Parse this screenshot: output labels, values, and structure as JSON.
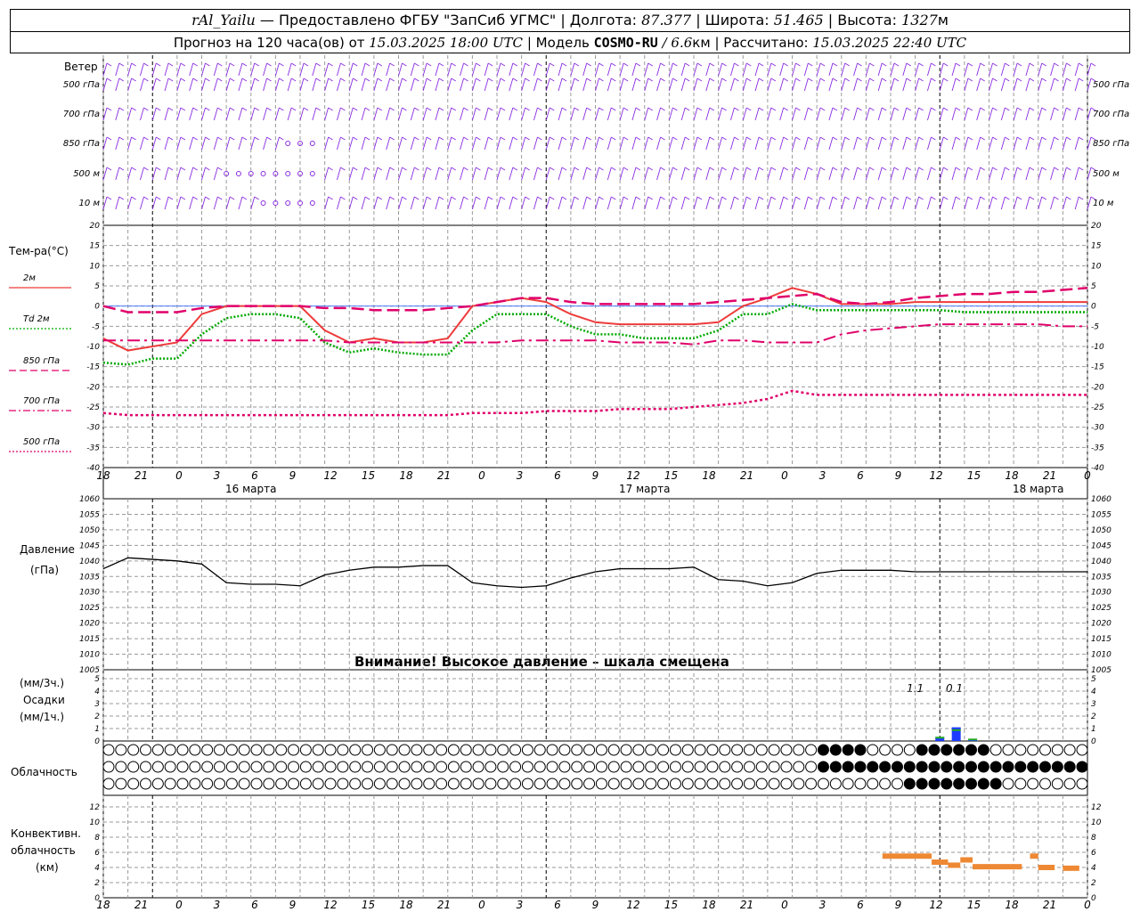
{
  "header": {
    "station": "rAl_Yailu",
    "provider": "— Предоставлено ФГБУ \"ЗапСиб УГМС\"",
    "lon_label": "Долгота:",
    "lon_value": "87.377",
    "lat_label": "Широта:",
    "lat_value": "51.465",
    "alt_label": "Высота:",
    "alt_value": "1327",
    "alt_unit": "м",
    "forecast_label": "Прогноз на 120 часа(ов) от",
    "forecast_from": "15.03.2025 18:00 UTC",
    "model_label": "Модель",
    "model_name": "COSMO-RU",
    "model_res": "/ 6.6",
    "model_res_unit": "км",
    "calc_label": "Рассчитано:",
    "calc_time": "15.03.2025 22:40 UTC"
  },
  "panels": {
    "wind": {
      "title": "Ветер",
      "levels": [
        "500 гПа",
        "700 гПа",
        "850 гПа",
        "500 м",
        "10  м"
      ],
      "color": "#8a2be2"
    },
    "temp": {
      "title": "Тем-ра(°C)",
      "legend": [
        {
          "name": "2м",
          "style": "solid",
          "color": "#ee3b3b"
        },
        {
          "name": "Td  2м",
          "style": "dotted",
          "color": "#00aa00"
        },
        {
          "name": "850 гПа",
          "style": "dashed",
          "color": "#e0006a"
        },
        {
          "name": "700 гПа",
          "style": "dashdot",
          "color": "#e0006a"
        },
        {
          "name": "500 гПа",
          "style": "dotted",
          "color": "#e0006a"
        }
      ],
      "yticks": [
        "20",
        "15",
        "10",
        "5",
        "0",
        "-5",
        "-10",
        "-15",
        "-20",
        "-25",
        "-30",
        "-35",
        "-40"
      ]
    },
    "pressure": {
      "title": "Давление",
      "unit": "(гПа)",
      "warning": "Внимание! Высокое давление – шкала смещена",
      "yticks": [
        "1060",
        "1055",
        "1050",
        "1045",
        "1040",
        "1035",
        "1030",
        "1025",
        "1020",
        "1015",
        "1010",
        "1005"
      ]
    },
    "precip": {
      "title": "Осадки",
      "unit_top": "(мм/3ч.)",
      "unit_bottom": "(мм/1ч.)",
      "yticks": [
        "5",
        "4",
        "3",
        "2",
        "1",
        "0"
      ],
      "annotations": [
        "1.1",
        "0.1"
      ]
    },
    "cloud": {
      "title": "Облачность"
    },
    "conv": {
      "title1": "Конвективн.",
      "title2": "облачность",
      "title3": "(км)",
      "yticks": [
        "12",
        "10",
        "8",
        "6",
        "4",
        "2",
        "0"
      ]
    }
  },
  "x_axis": {
    "hour_labels": [
      "18",
      "21",
      "0",
      "3",
      "6",
      "9",
      "12",
      "15",
      "18",
      "21",
      "0",
      "3",
      "6",
      "9",
      "12",
      "15",
      "18",
      "21",
      "0",
      "3",
      "6",
      "9",
      "12",
      "15",
      "18",
      "21",
      "0"
    ],
    "dates": [
      "16 марта",
      "17 марта",
      "18 марта"
    ]
  },
  "chart_data": [
    {
      "type": "line",
      "title": "Тем-ра(°C)",
      "x_hours": [
        0,
        3,
        6,
        9,
        12,
        15,
        18,
        21,
        24,
        27,
        30,
        33,
        36,
        39,
        42,
        45,
        48,
        51,
        54,
        57,
        60,
        63,
        66,
        69,
        72,
        75,
        78,
        81,
        84,
        87,
        90,
        93,
        96,
        99,
        102,
        105,
        108,
        111,
        114,
        117,
        120
      ],
      "ylim": [
        -40,
        20
      ],
      "series": [
        {
          "name": "2м",
          "values": [
            -8,
            -11,
            -10,
            -9,
            -2,
            0,
            0,
            0,
            0,
            -6,
            -9,
            -8,
            -9,
            -9,
            -8,
            0,
            1,
            2,
            1,
            -2,
            -4,
            -4.5,
            -4.5,
            -4.5,
            -4.5,
            -4,
            0,
            2,
            4.5,
            3,
            0.5,
            0.5,
            0.5,
            1,
            1,
            1,
            1,
            1,
            1,
            1,
            1
          ]
        },
        {
          "name": "Td  2м",
          "values": [
            -14,
            -14.5,
            -13,
            -13,
            -7,
            -3,
            -2,
            -2,
            -3,
            -9,
            -11.5,
            -10.5,
            -11.5,
            -12,
            -12,
            -6,
            -2,
            -2,
            -2,
            -5,
            -7,
            -7,
            -8,
            -8,
            -8,
            -6,
            -2,
            -2,
            0.5,
            -1,
            -1,
            -1,
            -1,
            -1,
            -1,
            -1.5,
            -1.5,
            -1.5,
            -1.5,
            -1.5,
            -1.5
          ]
        },
        {
          "name": "850 гПа",
          "values": [
            0,
            -1.5,
            -1.5,
            -1.5,
            -0.5,
            0,
            0,
            0,
            0,
            -0.5,
            -0.5,
            -1,
            -1,
            -1,
            -0.5,
            0,
            1,
            2,
            2,
            1,
            0.5,
            0.5,
            0.5,
            0.5,
            0.5,
            1,
            1.5,
            2,
            2.5,
            3,
            1,
            0.5,
            1,
            2,
            2.5,
            3,
            3,
            3.5,
            3.5,
            4,
            4.5
          ]
        },
        {
          "name": "700 гПа",
          "values": [
            -8.5,
            -8.5,
            -8.5,
            -8.5,
            -8.5,
            -8.5,
            -8.5,
            -8.5,
            -8.5,
            -8.5,
            -9,
            -9,
            -9,
            -9,
            -9,
            -9,
            -9,
            -8.5,
            -8.5,
            -8.5,
            -8.5,
            -9,
            -9,
            -9,
            -9.5,
            -8.5,
            -8.5,
            -9,
            -9,
            -9,
            -7,
            -6,
            -5.5,
            -5,
            -4.5,
            -4.5,
            -4.5,
            -4.5,
            -4.5,
            -5,
            -5
          ]
        },
        {
          "name": "500 гПа",
          "values": [
            -26.5,
            -27,
            -27,
            -27,
            -27,
            -27,
            -27,
            -27,
            -27,
            -27,
            -27,
            -27,
            -27,
            -27,
            -27,
            -26.5,
            -26.5,
            -26.5,
            -26,
            -26,
            -26,
            -25.5,
            -25.5,
            -25.5,
            -25,
            -24.5,
            -24,
            -23,
            -21,
            -22,
            -22,
            -22,
            -22,
            -22,
            -22,
            -22,
            -22,
            -22,
            -22,
            -22,
            -22
          ]
        }
      ]
    },
    {
      "type": "line",
      "title": "Давление",
      "x_hours": [
        0,
        3,
        6,
        9,
        12,
        15,
        18,
        21,
        24,
        27,
        30,
        33,
        36,
        39,
        42,
        45,
        48,
        51,
        54,
        57,
        60,
        63,
        66,
        69,
        72,
        75,
        78,
        81,
        84,
        87,
        90,
        93,
        96,
        99,
        102,
        105,
        108,
        111,
        114,
        117,
        120
      ],
      "ylim": [
        1005,
        1060
      ],
      "series": [
        {
          "name": "Давление",
          "values": [
            1037.5,
            1041,
            1040.5,
            1040,
            1039,
            1033,
            1032.5,
            1032.5,
            1032,
            1035.5,
            1037,
            1038,
            1038,
            1038.5,
            1038.5,
            1033,
            1032,
            1031.5,
            1032,
            1034.5,
            1036.5,
            1037.5,
            1037.5,
            1037.5,
            1038,
            1034,
            1033.5,
            1032,
            1033,
            1036,
            1037,
            1037,
            1037,
            1036.5,
            1036.5,
            1036.5,
            1036.5,
            1036.5,
            1036.5,
            1036.5,
            1036.5
          ]
        }
      ]
    },
    {
      "type": "bar",
      "title": "Осадки",
      "x_hours": [
        102,
        104,
        106
      ],
      "ylim": [
        0,
        5
      ],
      "series": [
        {
          "name": "мм/3ч.",
          "values": [
            0.3,
            1.1,
            0.1
          ]
        },
        {
          "name": "мм/1ч.",
          "values": [
            0.2,
            0.8,
            0.05
          ]
        }
      ]
    },
    {
      "type": "bar",
      "title": "Конвективн. облачность",
      "ylim": [
        0,
        13
      ],
      "segments": [
        {
          "x0": 95,
          "x1": 101,
          "y": 5.5
        },
        {
          "x0": 101,
          "x1": 103,
          "y": 4.7
        },
        {
          "x0": 103,
          "x1": 104.5,
          "y": 4.3
        },
        {
          "x0": 104.5,
          "x1": 106,
          "y": 5
        },
        {
          "x0": 106,
          "x1": 112,
          "y": 4.1
        },
        {
          "x0": 113,
          "x1": 114,
          "y": 5.5
        },
        {
          "x0": 114,
          "x1": 116,
          "y": 4
        },
        {
          "x0": 117,
          "x1": 119,
          "y": 3.9
        }
      ]
    }
  ],
  "colors": {
    "grid": "#9a9a9a",
    "wind": "#8a2be2",
    "precip_3h": "#1e3cff",
    "precip_1h": "#22aa22",
    "conv": "#ee8833"
  }
}
